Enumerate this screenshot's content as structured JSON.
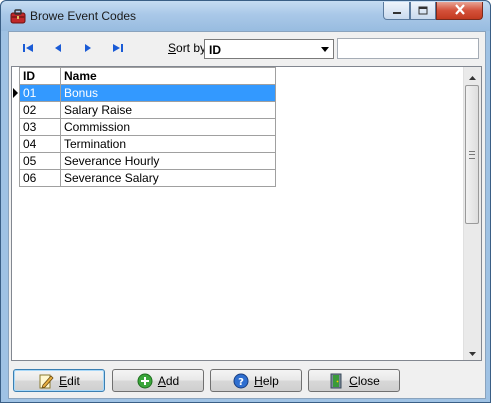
{
  "window": {
    "title": "Browe Event Codes"
  },
  "toolbar": {
    "first_icon": "first-record-icon",
    "prev_icon": "previous-record-icon",
    "next_icon": "next-record-icon",
    "last_icon": "last-record-icon",
    "sort_label_accel": "S",
    "sort_label_rest": "ort by",
    "sort_value": "ID",
    "search_value": ""
  },
  "grid": {
    "columns": [
      "ID",
      "Name"
    ],
    "rows": [
      {
        "id": "01",
        "name": "Bonus",
        "selected": true
      },
      {
        "id": "02",
        "name": "Salary Raise",
        "selected": false
      },
      {
        "id": "03",
        "name": "Commission",
        "selected": false
      },
      {
        "id": "04",
        "name": "Termination",
        "selected": false
      },
      {
        "id": "05",
        "name": "Severance Hourly",
        "selected": false
      },
      {
        "id": "06",
        "name": "Severance Salary",
        "selected": false
      }
    ]
  },
  "buttons": {
    "edit": "Edit",
    "add": "Add",
    "help": "Help",
    "close": "Close"
  },
  "colors": {
    "selection": "#3399ff",
    "nav_arrow": "#1a5bd6",
    "title_bar": "#a9c8e8"
  }
}
